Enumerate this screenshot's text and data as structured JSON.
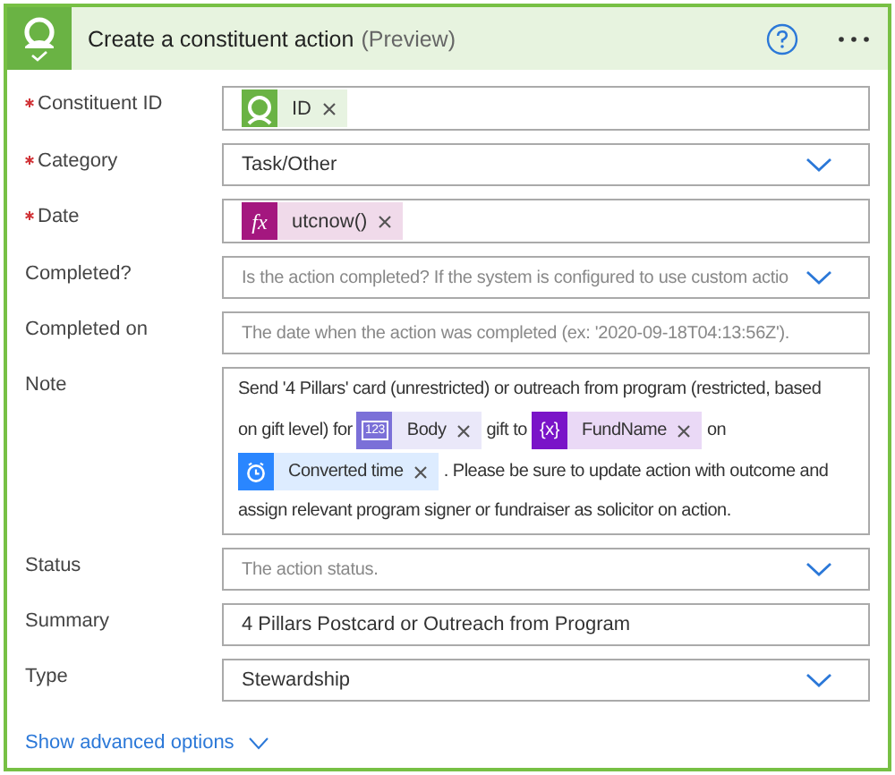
{
  "card": {
    "title": "Create a constituent action",
    "title_note": "(Preview)"
  },
  "fields": [
    {
      "label": "Constituent ID",
      "required": true,
      "kind": "tokens",
      "tokens": [
        {
          "kind": "person",
          "text": "ID",
          "color": "#6ab344"
        }
      ]
    },
    {
      "label": "Category",
      "required": true,
      "kind": "dropdown",
      "value": "Task/Other"
    },
    {
      "label": "Date",
      "required": true,
      "kind": "tokens",
      "tokens": [
        {
          "kind": "function",
          "glyph": "fx",
          "text": "utcnow()",
          "color": "#a4177f"
        }
      ]
    },
    {
      "label": "Completed?",
      "required": false,
      "kind": "dropdown",
      "placeholder": "Is the action completed? If the system is configured to use custom actio"
    },
    {
      "label": "Completed on",
      "required": false,
      "kind": "text",
      "placeholder": "The date when the action was completed (ex: '2020-09-18T04:13:56Z')."
    },
    {
      "label": "Note",
      "required": false,
      "kind": "rich",
      "parts": [
        {
          "kind": "text",
          "text": "Send '4 Pillars' card (unrestricted) or outreach from program (restricted, based"
        },
        {
          "kind": "text",
          "text": "on gift level) for"
        },
        {
          "kind": "number",
          "glyph": "123",
          "text": "Body",
          "color": "#7b70d8"
        },
        {
          "kind": "text",
          "text": "gift to"
        },
        {
          "kind": "variable",
          "glyph": "{x}",
          "text": "FundName",
          "color": "#7a14c8"
        },
        {
          "kind": "text",
          "text": "on"
        },
        {
          "kind": "clock",
          "text": "Converted time",
          "color": "#2a86ff"
        },
        {
          "kind": "text",
          "text": ". Please be sure to update action with outcome and"
        },
        {
          "kind": "text",
          "text": "assign relevant program signer or fundraiser as solicitor on action."
        }
      ]
    },
    {
      "label": "Status",
      "required": false,
      "kind": "dropdown",
      "placeholder": "The action status."
    },
    {
      "label": "Summary",
      "required": false,
      "kind": "text",
      "value": "4 Pillars Postcard or Outreach from Program"
    },
    {
      "label": "Type",
      "required": false,
      "kind": "dropdown",
      "value": "Stewardship"
    }
  ],
  "advanced_link": "Show advanced options"
}
